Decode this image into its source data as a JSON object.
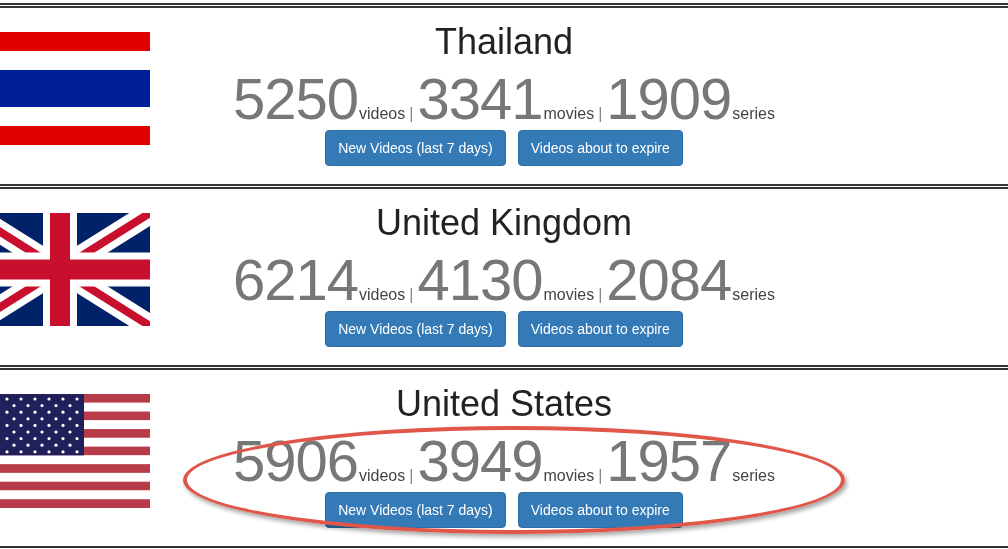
{
  "countries": [
    {
      "name": "Thailand",
      "kind": "thailand",
      "highlighted": false,
      "stats": [
        {
          "value": "5250",
          "unit": "videos",
          "separator": "|"
        },
        {
          "value": "3341",
          "unit": "movies",
          "separator": "|"
        },
        {
          "value": "1909",
          "unit": "series"
        }
      ],
      "buttons": [
        "New Videos (last 7 days)",
        "Videos about to expire"
      ]
    },
    {
      "name": "United Kingdom",
      "kind": "uk",
      "highlighted": false,
      "stats": [
        {
          "value": "6214",
          "unit": "videos",
          "separator": "|"
        },
        {
          "value": "4130",
          "unit": "movies",
          "separator": "|"
        },
        {
          "value": "2084",
          "unit": "series"
        }
      ],
      "buttons": [
        "New Videos (last 7 days)",
        "Videos about to expire"
      ]
    },
    {
      "name": "United States",
      "kind": "usa",
      "highlighted": true,
      "stats": [
        {
          "value": "5906",
          "unit": "videos",
          "separator": "|"
        },
        {
          "value": "3949",
          "unit": "movies",
          "separator": "|"
        },
        {
          "value": "1957",
          "unit": "series"
        }
      ],
      "buttons": [
        "New Videos (last 7 days)",
        "Videos about to expire"
      ]
    }
  ]
}
